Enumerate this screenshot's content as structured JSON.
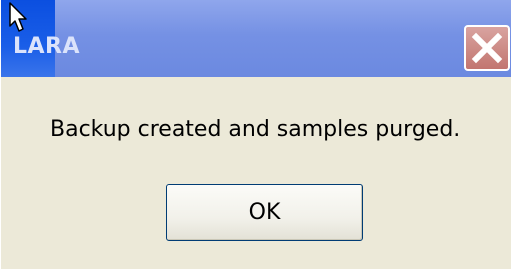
{
  "window": {
    "title": "LARA",
    "close_icon": "close-icon"
  },
  "dialog": {
    "message": "Backup created and samples purged.",
    "ok_label": "OK"
  },
  "colors": {
    "titlebar": "#7591e4",
    "title_text": "#dbe3fb",
    "close_button": "#cc8a85",
    "dialog_bg": "#ece9d8",
    "button_border": "#003c74"
  }
}
